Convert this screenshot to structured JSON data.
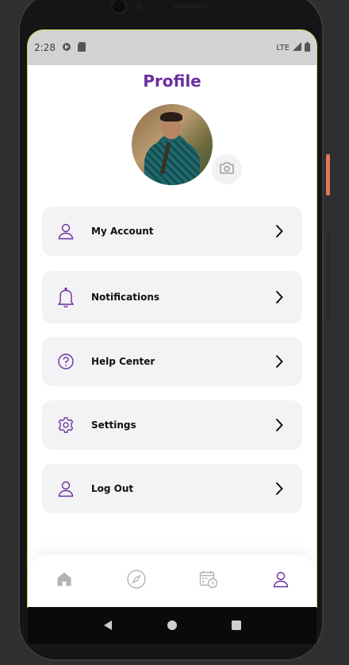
{
  "status_bar": {
    "time": "2:28",
    "network": "LTE"
  },
  "page": {
    "title": "Profile"
  },
  "menu": {
    "items": [
      {
        "label": "My Account",
        "icon": "user-icon"
      },
      {
        "label": "Notifications",
        "icon": "bell-icon"
      },
      {
        "label": "Help Center",
        "icon": "help-circle-icon"
      },
      {
        "label": "Settings",
        "icon": "gear-icon"
      },
      {
        "label": "Log Out",
        "icon": "user-icon"
      }
    ]
  },
  "bottom_nav": {
    "items": [
      {
        "name": "home",
        "icon": "home-icon",
        "active": false
      },
      {
        "name": "explore",
        "icon": "compass-icon",
        "active": false
      },
      {
        "name": "calendar",
        "icon": "calendar-clock-icon",
        "active": false
      },
      {
        "name": "profile",
        "icon": "user-icon",
        "active": true
      }
    ]
  },
  "colors": {
    "accent": "#6a2fa0",
    "card": "#f3f2f4",
    "inactive_icon": "#b3b3b3"
  }
}
